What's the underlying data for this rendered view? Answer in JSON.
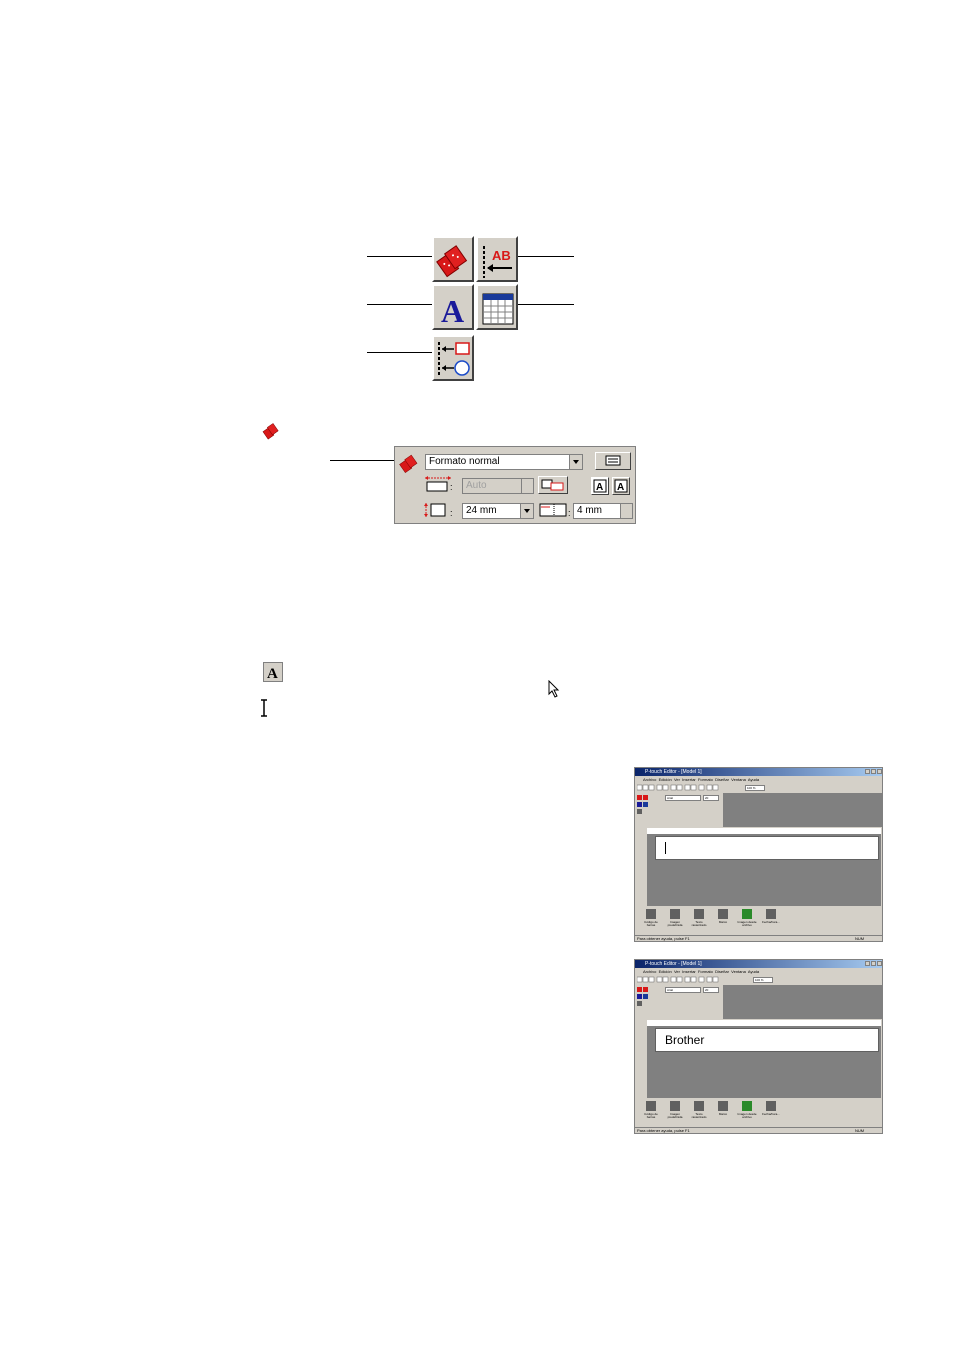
{
  "format_dock": {
    "format_value": "Formato normal",
    "length_value": "Auto",
    "width_value": "24 mm",
    "margin_value": "4 mm"
  },
  "screenshot_1": {
    "title": "P-touch Editor - [Model 1]",
    "menu": [
      "Archivo",
      "Edición",
      "Ver",
      "Insertar",
      "Formato",
      "Diseñar",
      "Ventana",
      "Ayuda"
    ],
    "zoom": "100 %",
    "font_name": "Arial",
    "font_size": "20",
    "bottom_buttons": [
      "Código de barras",
      "Imagen predefinida",
      "Texto rasterizado",
      "Marco",
      "Imagen desde archivo",
      "Fecha/hora..."
    ],
    "status": "Para obtener ayuda, pulse F1",
    "status_right": "NUM",
    "page_text": ""
  },
  "screenshot_2": {
    "title": "P-touch Editor - [Model 1]",
    "menu": [
      "Archivo",
      "Edición",
      "Ver",
      "Insertar",
      "Formato",
      "Diseñar",
      "Ventana",
      "Ayuda"
    ],
    "zoom": "100 %",
    "font_name": "Arial",
    "font_size": "20",
    "bottom_buttons": [
      "Código de barras",
      "Imagen predefinida",
      "Texto rasterizado",
      "Marco",
      "Imagen desde archivo",
      "Fecha/hora..."
    ],
    "status": "Para obtener ayuda, pulse F1",
    "status_right": "NUM",
    "page_text": "Brother"
  },
  "colors": {
    "icon_red": "#d81818",
    "icon_blue": "#1a1a9a",
    "button_face": "#d4d0c8",
    "title_blue": "#0a246a"
  }
}
